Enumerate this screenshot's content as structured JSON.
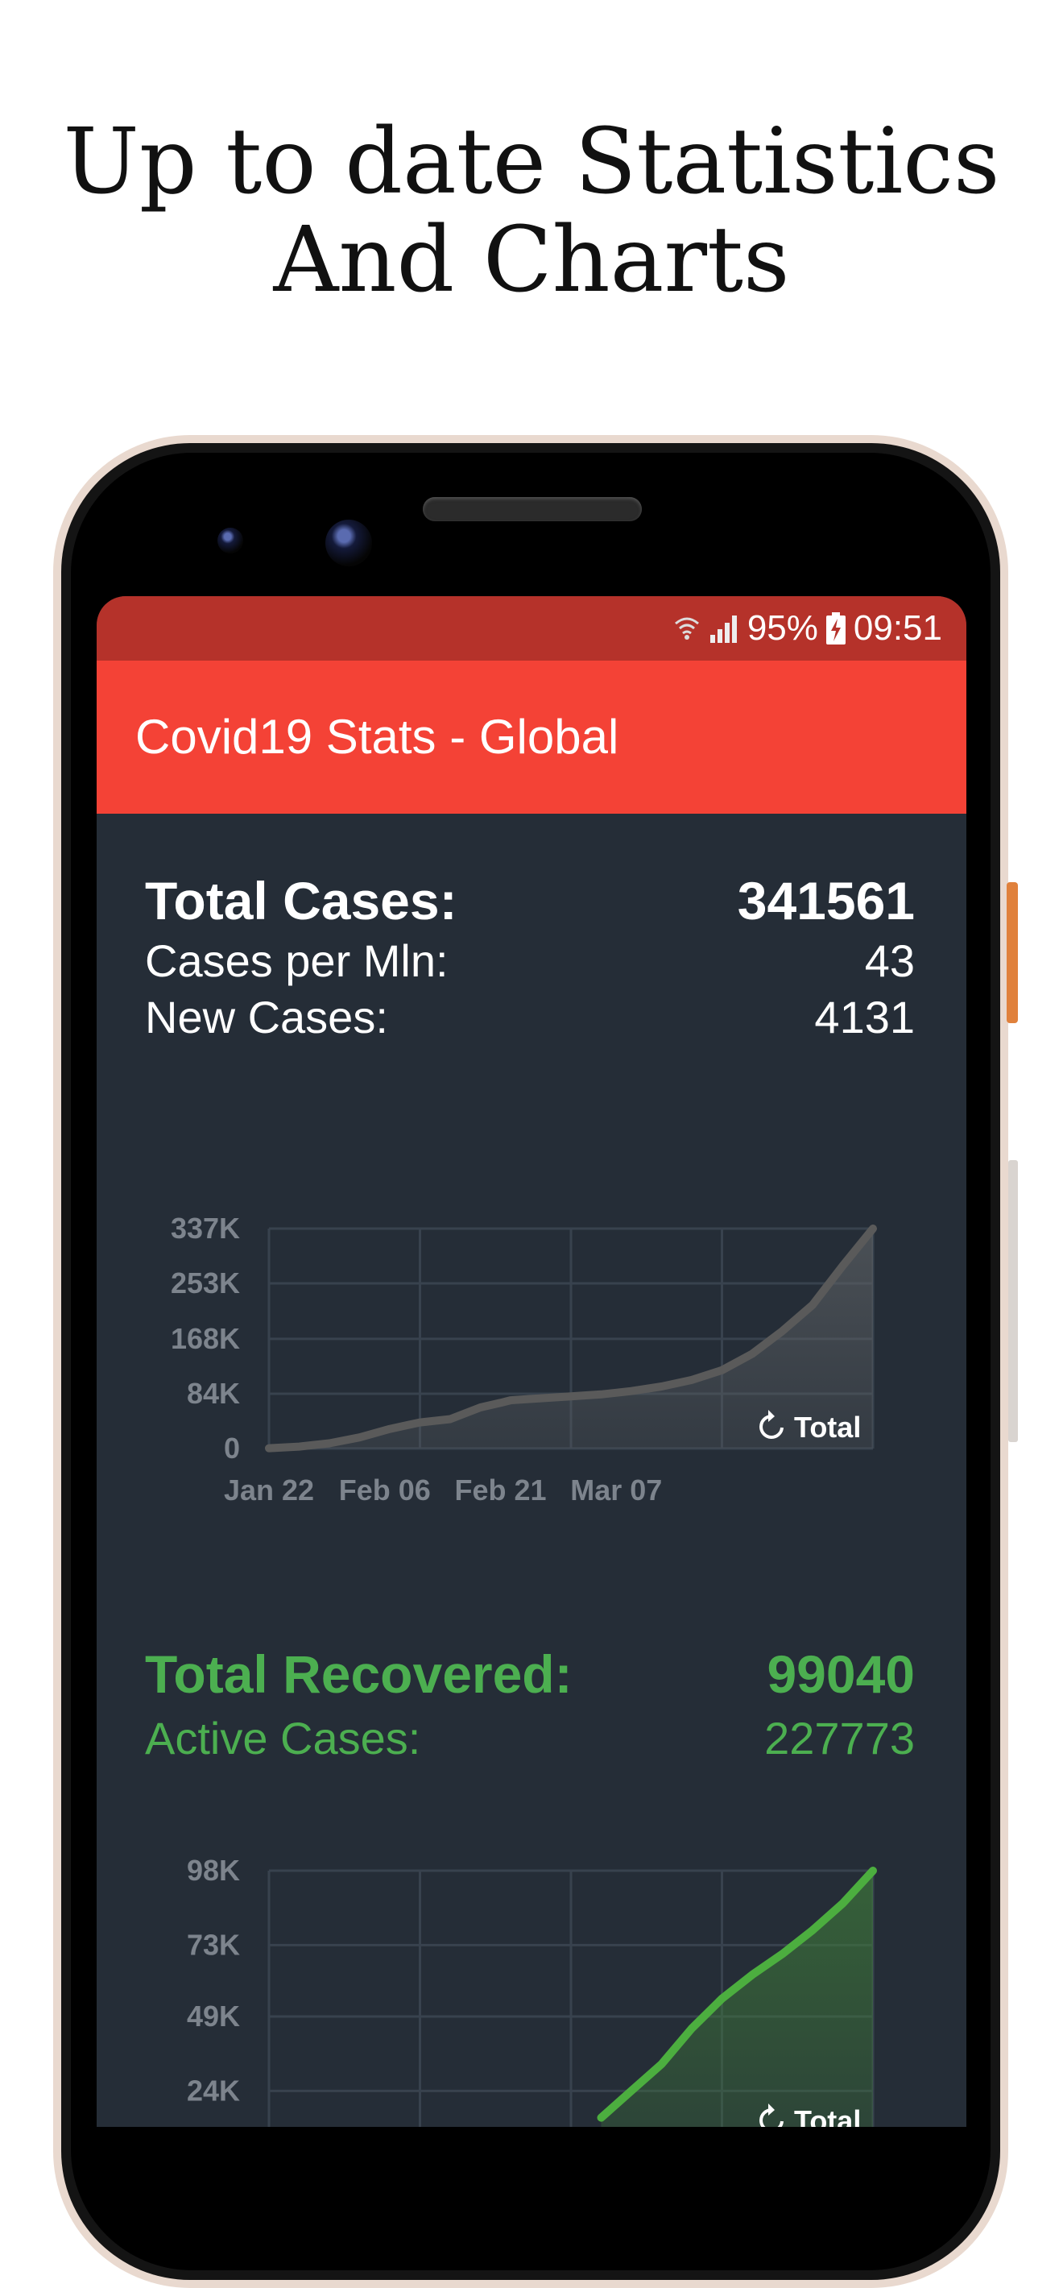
{
  "headline": {
    "line1": "Up to date Statistics",
    "line2": "And Charts"
  },
  "status_bar": {
    "battery": "95%",
    "time": "09:51",
    "icons": [
      "wifi-icon",
      "signal-icon",
      "battery-charging-icon"
    ]
  },
  "app_bar": {
    "title": "Covid19 Stats - Global"
  },
  "cases": {
    "total_label": "Total Cases:",
    "total_value": "341561",
    "per_mln_label": "Cases per Mln:",
    "per_mln_value": "43",
    "new_label": "New Cases:",
    "new_value": "4131"
  },
  "recovered": {
    "total_label": "Total Recovered:",
    "total_value": "99040",
    "active_label": "Active Cases:",
    "active_value": "227773"
  },
  "colors": {
    "accent": "#f44236",
    "status": "#b5322a",
    "background": "#252d37",
    "green": "#4caf50",
    "cases_line": "#5a5a5a"
  },
  "chart_data": [
    {
      "type": "area",
      "y_ticks": [
        "0",
        "84K",
        "168K",
        "253K",
        "337K"
      ],
      "x_ticks": [
        "Jan 22",
        "Feb 06",
        "Feb 21",
        "Mar 07"
      ],
      "ylim": [
        0,
        337000
      ],
      "legend": {
        "label": "Total",
        "icon": "refresh-icon"
      },
      "series": [
        {
          "name": "Total",
          "x": [
            0,
            3,
            6,
            9,
            12,
            15,
            18,
            21,
            23,
            24,
            27,
            30,
            33,
            36,
            39,
            42,
            45,
            48,
            51,
            54,
            57,
            60
          ],
          "values": [
            500,
            3000,
            8000,
            17000,
            30000,
            40000,
            45000,
            63000,
            70000,
            74000,
            77000,
            80000,
            83000,
            88000,
            95000,
            105000,
            120000,
            145000,
            180000,
            220000,
            280000,
            337000
          ]
        }
      ]
    },
    {
      "type": "area",
      "y_ticks": [
        "24K",
        "49K",
        "73K",
        "98K"
      ],
      "x_ticks": [],
      "ylim": [
        0,
        98000
      ],
      "legend": {
        "label": "Total",
        "icon": "refresh-icon"
      },
      "series": [
        {
          "name": "Total",
          "x": [
            33,
            36,
            39,
            42,
            45,
            48,
            51,
            54,
            57,
            60
          ],
          "values": [
            15000,
            24000,
            33000,
            45000,
            55000,
            63000,
            70000,
            78000,
            87000,
            98000
          ]
        }
      ]
    }
  ]
}
